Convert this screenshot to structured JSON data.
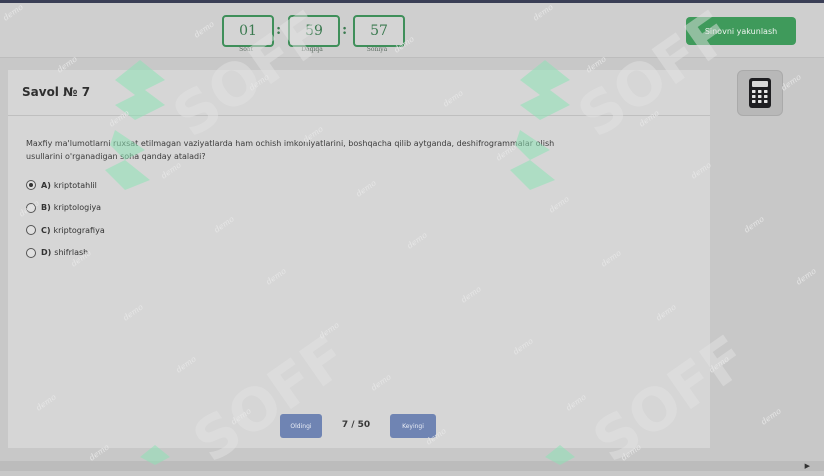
{
  "timer": {
    "hours": "01",
    "hours_label": "Soat",
    "minutes": "59",
    "minutes_label": "Daqiqa",
    "seconds": "57",
    "seconds_label": "Soniya",
    "separator": ":"
  },
  "header": {
    "finish_label": "Sinovni yakunlash"
  },
  "question": {
    "title": "Savol № 7",
    "text": "Maxfiy ma'lumotlarni ruxsat etilmagan vaziyatlarda ham ochish imkoniyatlarini, boshqacha qilib aytganda, deshifrogrammalar olish usullarini o'rganadigan soha qanday ataladi?",
    "options": [
      {
        "letter": "A)",
        "text": "kriptotahlil",
        "selected": true
      },
      {
        "letter": "B)",
        "text": "kriptologiya",
        "selected": false
      },
      {
        "letter": "C)",
        "text": "kriptografiya",
        "selected": false
      },
      {
        "letter": "D)",
        "text": "shifrlash",
        "selected": false
      }
    ]
  },
  "nav": {
    "prev_label": "Oldingi",
    "next_label": "Keyingi",
    "page": "7 / 50"
  },
  "watermark": {
    "word": "demo",
    "brand": "SOFF"
  },
  "icons": {
    "calculator": "calculator-icon",
    "radio": "radio-icon",
    "scroll": "scroll-right-arrow-icon"
  },
  "colors": {
    "accent_green": "#3f9a5b",
    "nav_blue": "#6f84b3",
    "timer_green": "#3b7a50"
  }
}
